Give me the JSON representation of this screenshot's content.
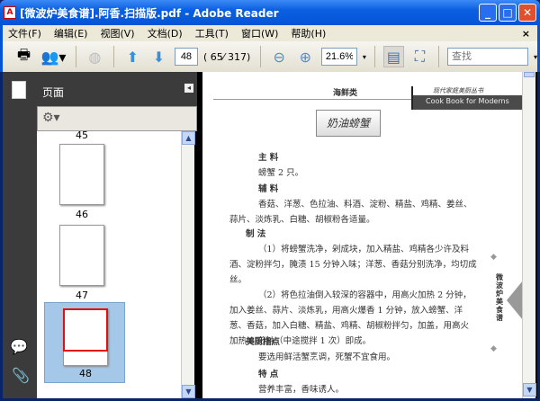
{
  "window": {
    "title": "[微波炉美食谱].阿香.扫描版.pdf - Adobe Reader",
    "min": "_",
    "max": "□",
    "close": "✕"
  },
  "menu": [
    "文件(F)",
    "编辑(E)",
    "视图(V)",
    "文档(D)",
    "工具(T)",
    "窗口(W)",
    "帮助(H)"
  ],
  "menu_close": "×",
  "toolbar": {
    "page_value": "48",
    "page_count": "( 65⁄ 317)",
    "zoom_value": "21.6%",
    "search_placeholder": "查找"
  },
  "panel": {
    "title": "页面",
    "collapse": "◂"
  },
  "thumbnails": [
    {
      "label": "45"
    },
    {
      "label": "46"
    },
    {
      "label": "47"
    },
    {
      "label": "48",
      "selected": true
    }
  ],
  "page": {
    "section": "海鲜类",
    "series": "现代家庭美厨丛书",
    "series_en": "Cook Book for Moderns",
    "dish": "奶油螃蟹",
    "h_main": "主  料",
    "main": "螃蟹 2 只。",
    "h_aux": "辅  料",
    "aux": "香菇、洋葱、色拉油、料酒、淀粉、精盐、鸡精、姜丝、蒜片、淡炼乳、白糖、胡椒粉各适量。",
    "h_method": "制  法",
    "step1": "（1）将螃蟹洗净，剁成块，加入精盐、鸡精各少许及料酒、淀粉拌匀，腌渍 15 分钟入味；洋葱、香菇分别洗净，均切成丝。",
    "step2": "（2）将色拉油倒入较深的容器中，用高火加热 2 分钟，加入姜丝、蒜片、淡炼乳，用高火爆香 1 分钟，放入螃蟹、洋葱、香菇，加入白糖、精盐、鸡精、胡椒粉拌匀，加盖，用高火加热 8 分钟（中途搅拌 1 次）即成。",
    "h_tips": "美厨指点",
    "tips": "要选用鲜活蟹烹调，死蟹不宜食用。",
    "h_feat": "特  点",
    "feat": "营养丰富，香味诱人。",
    "side_tab": "微波炉美食谱"
  },
  "colors": {
    "accent": "#0554d8",
    "selected_thumb": "#a6c8e8"
  }
}
